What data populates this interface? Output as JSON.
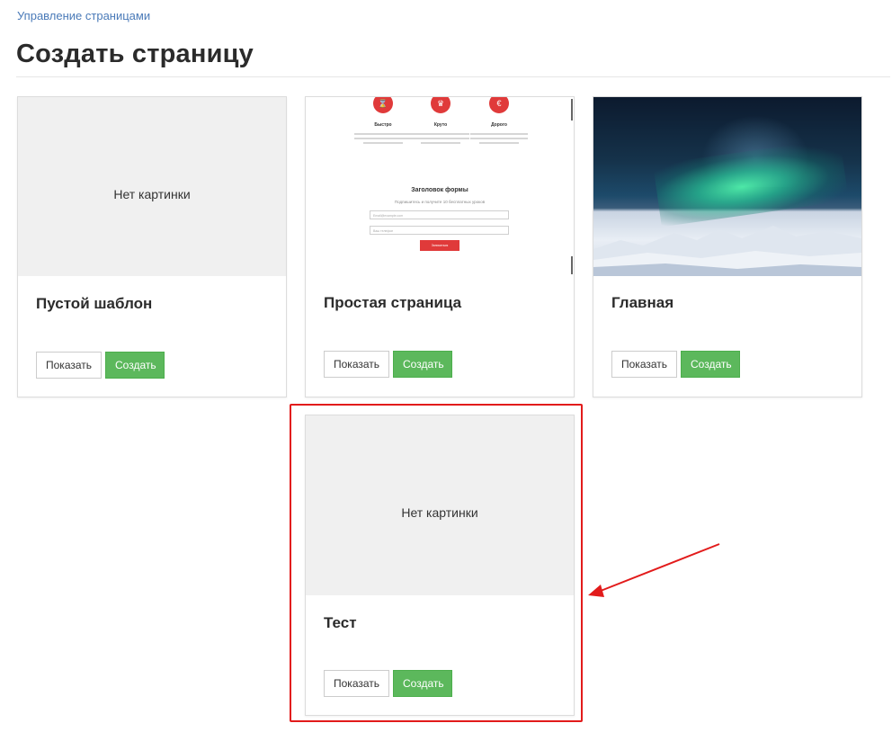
{
  "breadcrumb": {
    "label": "Управление страницами"
  },
  "page_title": "Создать страницу",
  "cards": [
    {
      "title": "Пустой шаблон",
      "image": "none",
      "no_image_text": "Нет картинки",
      "show_label": "Показать",
      "create_label": "Создать"
    },
    {
      "title": "Простая страница",
      "image": "template-preview",
      "show_label": "Показать",
      "create_label": "Создать",
      "preview": {
        "features": [
          {
            "icon": "hourglass-icon",
            "label": "Быстро"
          },
          {
            "icon": "crown-icon",
            "label": "Круто"
          },
          {
            "icon": "euro-icon",
            "label": "Дорого"
          }
        ],
        "form_title": "Заголовок формы",
        "form_subtitle": "Подпишитесь и получите 10 бесплатных уроков",
        "email_placeholder": "Email@example.com",
        "phone_placeholder": "Ваш телефон",
        "submit_label": "Записаться"
      }
    },
    {
      "title": "Главная",
      "image": "aurora-photo",
      "show_label": "Показать",
      "create_label": "Создать"
    },
    {
      "title": "Тест",
      "image": "none",
      "no_image_text": "Нет картинки",
      "show_label": "Показать",
      "create_label": "Создать"
    }
  ],
  "annotation": {
    "highlight_color": "#e21b1b"
  },
  "colors": {
    "link": "#4a7ab8",
    "create_button": "#5cb85c",
    "placeholder_bg": "#f0f0f0",
    "accent_red": "#e03a3a"
  }
}
